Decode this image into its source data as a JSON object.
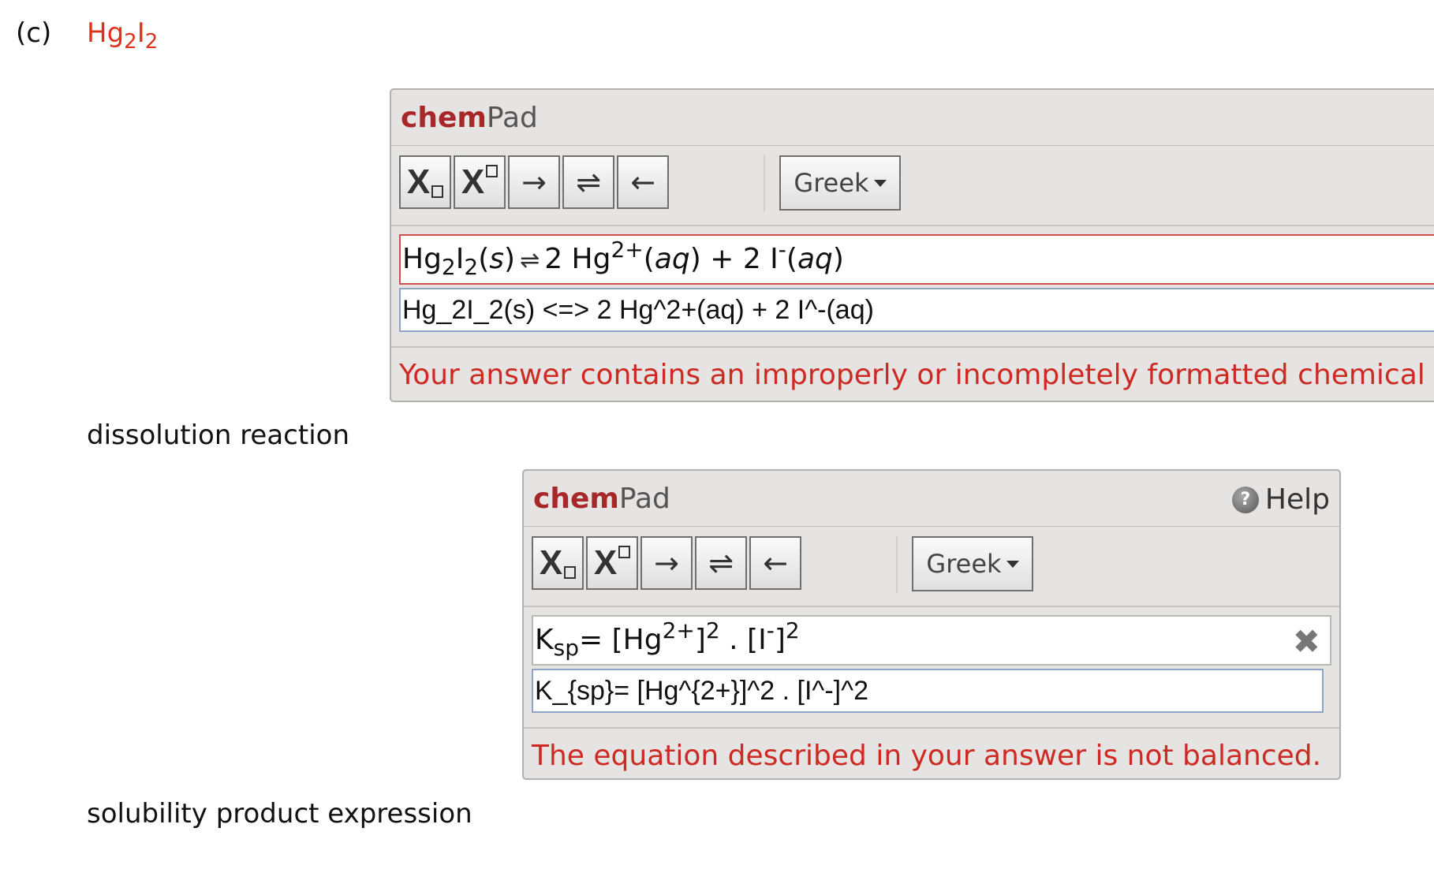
{
  "part": {
    "label": "(c)",
    "compound": {
      "base1": "Hg",
      "sub1": "2",
      "base2": "I",
      "sub2": "2"
    }
  },
  "brand": {
    "chem": "chem",
    "pad": "Pad"
  },
  "toolbar": {
    "subscript_label": "X",
    "superscript_label": "X",
    "arrow_right": "→",
    "equilibrium": "⇌",
    "arrow_left": "←",
    "greek_label": "Greek"
  },
  "pad1": {
    "rendered": {
      "t1": "Hg",
      "t1sub": "2",
      "t2": "I",
      "t2sub": "2",
      "t3": "(",
      "t3i": "s",
      "t4": ")",
      "arrows": "⇌",
      "t5": "2 Hg",
      "t5sup": "2+",
      "t6": "(",
      "t6i": "aq",
      "t7": ") + 2 I",
      "t7sup": "-",
      "t8": "(",
      "t8i": "aq",
      "t9": ")"
    },
    "raw_input": "Hg_2I_2(s) <=> 2 Hg^2+(aq) + 2 I^-(aq)",
    "message": "Your answer contains an improperly or incompletely formatted chemical",
    "caption": "dissolution reaction"
  },
  "pad2": {
    "help_label": "Help",
    "help_icon_glyph": "?",
    "rendered": {
      "k": "K",
      "ksub": "sp",
      "eq": "= [Hg",
      "sup1": "2+",
      "b1": "]",
      "sup2": "2",
      "dot": " . [I",
      "sup3": "-",
      "b2": "]",
      "sup4": "2"
    },
    "clear_glyph": "✖",
    "raw_input": "K_{sp}= [Hg^{2+}]^2 . [I^-]^2",
    "message": "The equation described in your answer is not balanced.",
    "caption": "solubility product expression"
  }
}
